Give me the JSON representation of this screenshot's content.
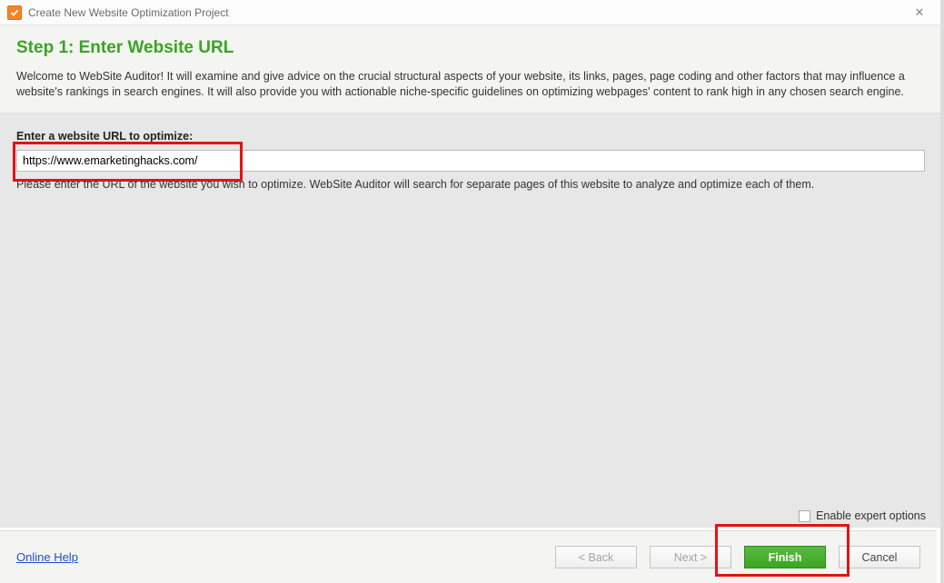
{
  "titlebar": {
    "title": "Create New Website Optimization Project"
  },
  "header": {
    "step_title": "Step 1: Enter Website URL",
    "welcome_text": "Welcome to WebSite Auditor! It will examine and give advice on the crucial structural aspects of your website, its links, pages, page coding and other factors that may influence a website's rankings in search engines. It will also provide you with actionable niche-specific guidelines on optimizing webpages' content to rank high in any chosen search engine."
  },
  "form": {
    "url_label": "Enter a website URL to optimize:",
    "url_value": "https://www.emarketinghacks.com/",
    "url_hint": "Please enter the URL of the website you wish to optimize. WebSite Auditor will search for separate pages of this website to analyze and optimize each of them."
  },
  "options": {
    "expert_label": "Enable expert options"
  },
  "footer": {
    "help_link": "Online Help",
    "back_label": "< Back",
    "next_label": "Next >",
    "finish_label": "Finish",
    "cancel_label": "Cancel"
  }
}
